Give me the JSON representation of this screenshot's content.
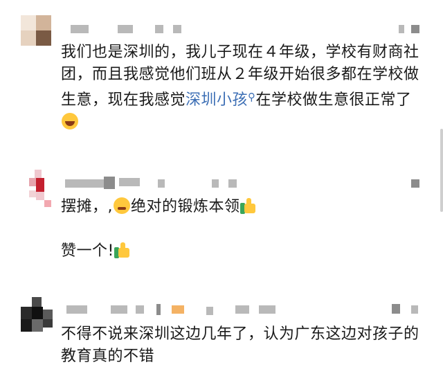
{
  "comments": [
    {
      "text_before_link": "我们也是深圳的，我儿子现在４年级，学校有财商社团，而且我感觉他们班从２年级开始很多都在学校做生意，现在我感觉",
      "link_text": "深圳小孩",
      "link_icon": "search-icon",
      "text_after_link": "在学校做生意很正常了",
      "trailing_icon": "laughing-face-icon"
    },
    {
      "line1_before": "摆摊，,",
      "line1_icon1": "winking-face-icon",
      "line1_mid": "绝对的锻炼本领",
      "line1_icon2": "thumbs-up-icon",
      "line2_text": "赞一个!",
      "line2_icon": "thumbs-up-icon"
    },
    {
      "text": "不得不说来深圳这边几年了，认为广东这边对孩子的教育真的不错"
    }
  ],
  "colors": {
    "link": "#3d6fb5",
    "text": "#1a1a1a",
    "background": "#ffffff"
  }
}
